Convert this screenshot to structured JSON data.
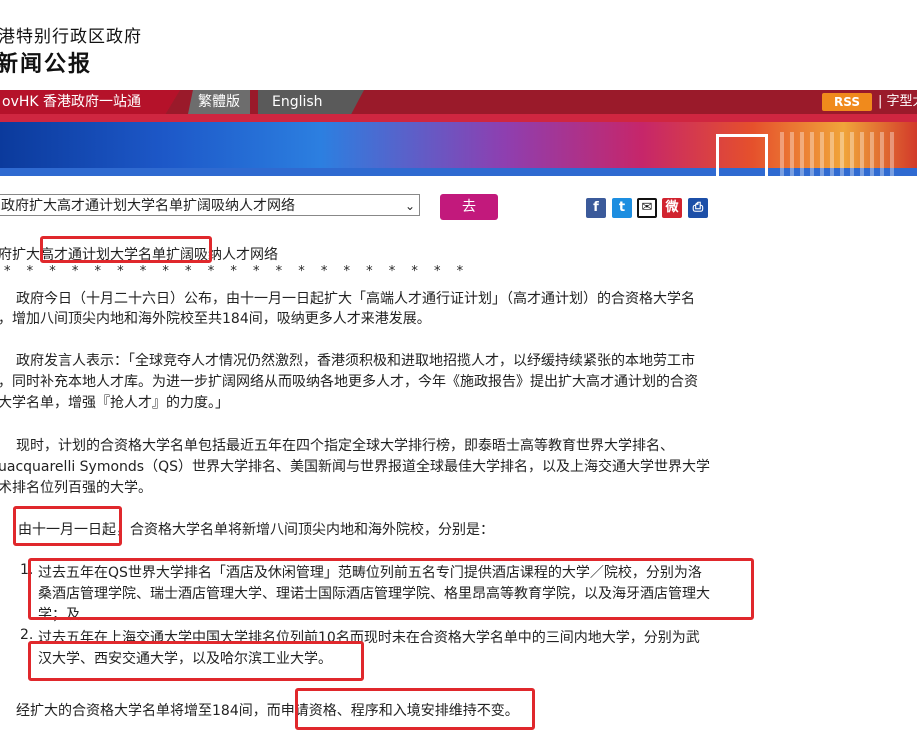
{
  "header": {
    "gov_name": "港特别行政区政府",
    "gazette": "新闻公报"
  },
  "nav": {
    "govhk": "ovHK 香港政府一站通",
    "traditional": "繁體版",
    "english": "English",
    "rss": "RSS",
    "font_size": "| 字型大"
  },
  "selector": {
    "value": "政府扩大高才通计划大学名单扩阔吸纳人才网络",
    "go_label": "去"
  },
  "share": {
    "facebook": "f",
    "twitter": "t",
    "email": "✉",
    "weibo": "微",
    "print": "⎙"
  },
  "article": {
    "title_pre": "府扩大",
    "title_hl": "高才通计划大学名单扩阔",
    "title_post": "吸纳人才网络",
    "stars": "* * * * * * * * * * * * * * * * * * * * *",
    "p1_l1": "政府今日（十月二十六日）公布，由十一月一日起扩大「高端人才通行证计划」（高才通计划）的合资格大学名",
    "p1_l2": "，增加八间顶尖内地和海外院校至共184间，吸纳更多人才来港发展。",
    "p2_l1": "政府发言人表示：「全球竞夺人才情况仍然激烈，香港须积极和进取地招揽人才，以纾缓持续紧张的本地劳工市",
    "p2_l2": "，同时补充本地人才库。为进一步扩阔网络从而吸纳各地更多人才，今年《施政报告》提出扩大高才通计划的合资",
    "p2_l3": "大学名单，增强『抢人才』的力度。」",
    "p3_l1": "现时，计划的合资格大学名单包括最近五年在四个指定全球大学排行榜，即泰晤士高等教育世界大学排名、",
    "p3_l2": "uacquarelli Symonds（QS）世界大学排名、美国新闻与世界报道全球最佳大学排名，以及上海交通大学世界大学",
    "p3_l3": "术排名位列百强的大学。",
    "p4_hl": "由十一月一日起",
    "p4_rest": "，合资格大学名单将新增八间顶尖内地和海外院校，分别是：",
    "item1_num": "1.",
    "item1_l1": "过去五年在QS世界大学排名「酒店及休闲管理」范畴位列前五名专门提供酒店课程的大学／院校，分别为洛",
    "item1_l2": "桑酒店管理学院、瑞士酒店管理大学、理诺士国际酒店管理学院、格里昂高等教育学院，以及海牙酒店管理大",
    "item1_l3": "学；及",
    "item2_num": "2.",
    "item2_l1": "过去五年在上海交通大学中国大学排名位列前10名而现时未在合资格大学名单中的三间内地大学，分别为武",
    "item2_l2": "汉大学、西安交通大学，以及哈尔滨工业大学。",
    "p5_pre": "经扩大的合资格大学名单将增至184间，而",
    "p5_hl": "申请资格、程序和入境安排维持不变",
    "p5_post": "。"
  },
  "colors": {
    "highlight": "#e0282c",
    "nav_red": "#b5122a",
    "go_button": "#c2197c"
  }
}
